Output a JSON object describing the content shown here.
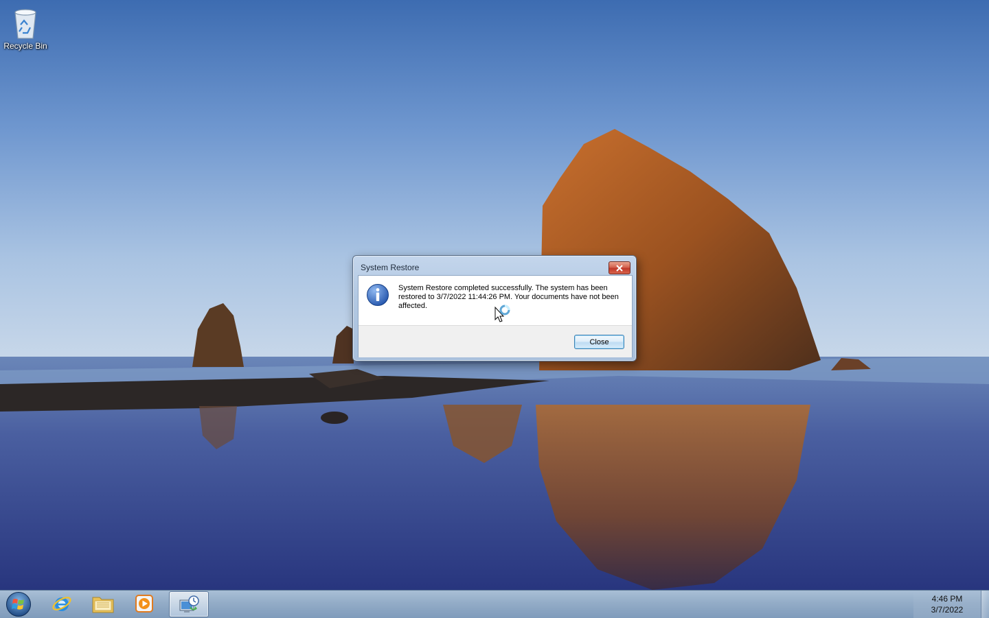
{
  "desktop": {
    "icons": [
      {
        "label": "Recycle Bin",
        "icon": "recycle-bin-icon"
      }
    ]
  },
  "dialog": {
    "title": "System Restore",
    "message": "System Restore completed successfully. The system has been restored to 3/7/2022 11:44:26 PM. Your documents have not been affected.",
    "icon": "information-icon",
    "close_button_label": "Close"
  },
  "taskbar": {
    "pinned": [
      {
        "name": "start-button",
        "icon": "windows-logo-icon"
      },
      {
        "name": "internet-explorer",
        "icon": "internet-explorer-icon"
      },
      {
        "name": "windows-explorer",
        "icon": "folder-icon"
      },
      {
        "name": "windows-media-player",
        "icon": "media-player-icon"
      },
      {
        "name": "system-restore",
        "icon": "system-restore-icon",
        "active": true
      }
    ],
    "clock": {
      "time": "4:46 PM",
      "date": "3/7/2022"
    }
  },
  "colors": {
    "taskbar": "#93acc7",
    "dialog_frame": "#b2c8e2",
    "close_x": "#c0392b",
    "sky_top": "#3f6fb3",
    "sea": "#2f3e8c"
  }
}
